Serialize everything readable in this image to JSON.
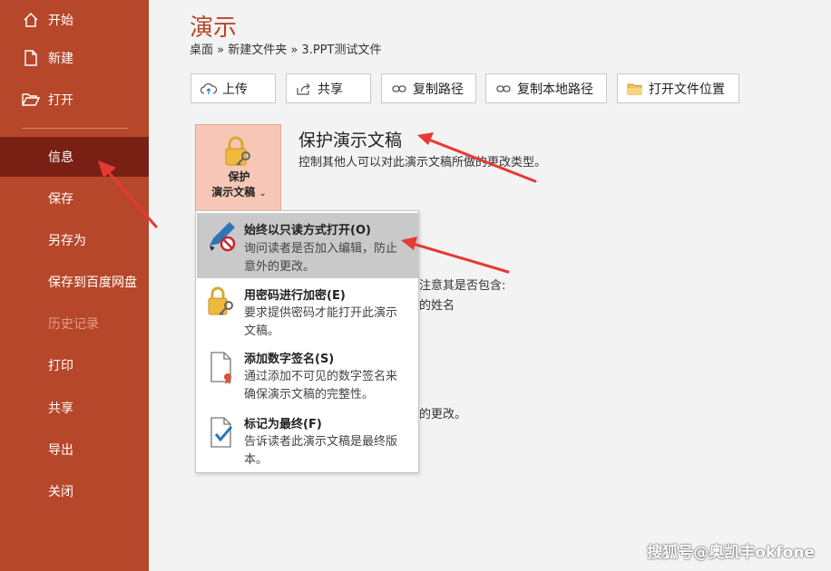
{
  "sidebar": {
    "items": [
      {
        "label": "开始",
        "icon": "home-icon"
      },
      {
        "label": "新建",
        "icon": "new-doc-icon"
      },
      {
        "label": "打开",
        "icon": "folder-open-icon"
      },
      {
        "label": "信息"
      },
      {
        "label": "保存"
      },
      {
        "label": "另存为"
      },
      {
        "label": "保存到百度网盘"
      },
      {
        "label": "历史记录"
      },
      {
        "label": "打印"
      },
      {
        "label": "共享"
      },
      {
        "label": "导出"
      },
      {
        "label": "关闭"
      }
    ]
  },
  "header": {
    "title": "演示",
    "breadcrumb": "桌面 » 新建文件夹 » 3.PPT测试文件"
  },
  "toolbar": {
    "upload": "上传",
    "share": "共享",
    "copy_path": "复制路径",
    "copy_local_path": "复制本地路径",
    "open_location": "打开文件位置"
  },
  "protect": {
    "button_line1": "保护",
    "button_line2": "演示文稿",
    "chevron": "⌄",
    "title": "保护演示文稿",
    "desc": "控制其他人可以对此演示文稿所做的更改类型。"
  },
  "background_text": {
    "line1": "注意其是否包含:",
    "line2": "的姓名",
    "line3": "的更改。"
  },
  "menu": {
    "items": [
      {
        "title": "始终以只读方式打开(O)",
        "desc": "询问读者是否加入编辑，防止意外的更改。"
      },
      {
        "title": "用密码进行加密(E)",
        "desc": "要求提供密码才能打开此演示文稿。"
      },
      {
        "title": "添加数字签名(S)",
        "desc": "通过添加不可见的数字签名来确保演示文稿的完整性。"
      },
      {
        "title": "标记为最终(F)",
        "desc": "告诉读者此演示文稿是最终版本。"
      }
    ]
  },
  "watermark": "搜狐号@奥凯丰okfone",
  "colors": {
    "accent": "#b7472a",
    "active": "#7a1f14",
    "arrow": "#e53935"
  }
}
